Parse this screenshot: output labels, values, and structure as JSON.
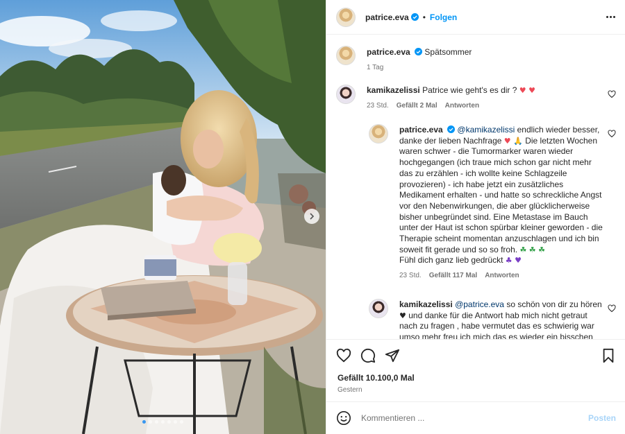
{
  "photo": {
    "carousel_count": 7,
    "active_index": 1
  },
  "header": {
    "username": "patrice.eva",
    "separator": "•",
    "follow_label": "Folgen"
  },
  "caption": {
    "username": "patrice.eva",
    "text": "Spätsommer",
    "time": "1 Tag"
  },
  "comments": [
    {
      "username": "kamikazelissi",
      "text": "Patrice wie geht's es dir ?",
      "emoji": "♥ ♥",
      "time": "23 Std.",
      "likes": "Gefällt 2 Mal",
      "reply": "Antworten"
    },
    {
      "username": "patrice.eva",
      "mention": "@kamikazelissi",
      "text_a": "endlich wieder besser, danke der lieben Nachfrage",
      "emoji_a": "♥ 🙏",
      "text_b": "Die letzten Wochen waren schwer - die Tumormarker waren wieder hochgegangen (ich traue mich schon gar nicht mehr das zu erzählen - ich wollte keine Schlagzeile provozieren) - ich habe jetzt ein zusätzliches Medikament erhalten - und hatte so schreckliche Angst vor den Nebenwirkungen, die aber glücklicherweise bisher unbegründet sind. Eine Metastase im Bauch unter der Haut ist schon spürbar kleiner geworden - die Therapie scheint momentan anzuschlagen und ich bin soweit fit gerade und so so froh.",
      "emoji_b": "☘ ☘ ☘",
      "text_c": "Fühl dich ganz lieb gedrückt",
      "emoji_c": "♣ ♥",
      "time": "23 Std.",
      "likes": "Gefällt 117 Mal",
      "reply": "Antworten"
    },
    {
      "username": "kamikazelissi",
      "mention": "@patrice.eva",
      "text_a": "so schön von dir zu hören",
      "emoji_a": "♥",
      "text_b": "und danke für die Antwort hab mich nicht getraut nach zu fragen , habe vermutet das es schwierig war umso mehr freu ich mich das es wieder ein bisschen"
    }
  ],
  "actions": {
    "icons": [
      "heart-icon",
      "comment-icon",
      "share-icon",
      "bookmark-icon"
    ],
    "likes": "Gefällt 10.100,0 Mal",
    "date": "Gestern"
  },
  "compose": {
    "placeholder": "Kommentieren ...",
    "post_label": "Posten"
  },
  "colors": {
    "accent": "#0095f6",
    "text": "#262626",
    "muted": "#737373",
    "post_disabled": "#a8d4f8"
  }
}
